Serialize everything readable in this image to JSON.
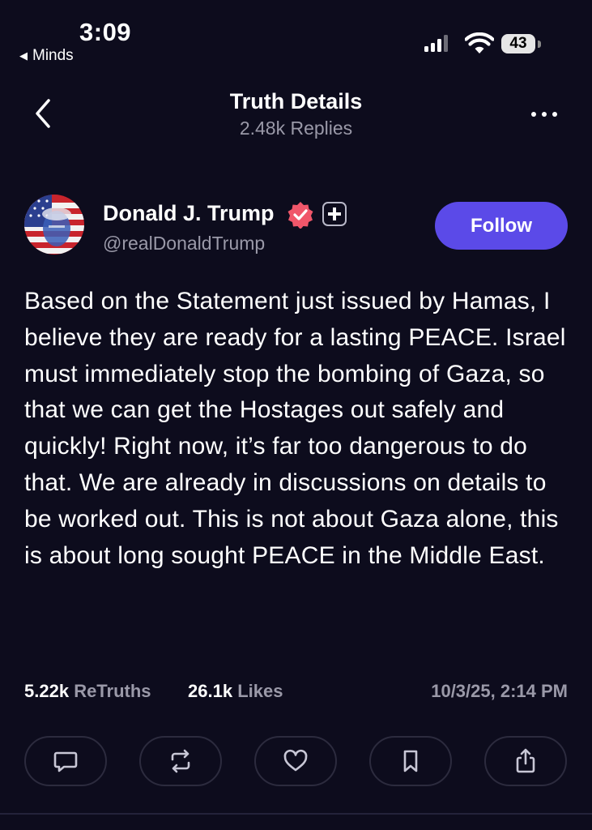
{
  "status_bar": {
    "time": "3:09",
    "back_app": "Minds",
    "battery": "43"
  },
  "header": {
    "title": "Truth Details",
    "subtitle": "2.48k Replies"
  },
  "post": {
    "author_name": "Donald J. Trump",
    "handle": "@realDonaldTrump",
    "follow_label": "Follow",
    "body": "Based on the Statement just issued by Hamas, I believe they are ready for a lasting PEACE. Israel must immediately stop the bombing of Gaza, so that we can get the Hostages out safely and quickly! Right now, it’s far too dangerous to do that. We are already in discussions on details to be worked out. This is not about Gaza alone, this is about long sought PEACE in the Middle East.",
    "retruths_count": "5.22k",
    "retruths_label": "ReTruths",
    "likes_count": "26.1k",
    "likes_label": "Likes",
    "timestamp": "10/3/25, 2:14 PM"
  },
  "actions": [
    "comment-icon",
    "retruth-icon",
    "heart-icon",
    "bookmark-icon",
    "share-icon"
  ],
  "colors": {
    "background": "#0d0c1d",
    "accent": "#5b4ae8",
    "muted_text": "#9a99a8",
    "verified": "#f0566a"
  }
}
